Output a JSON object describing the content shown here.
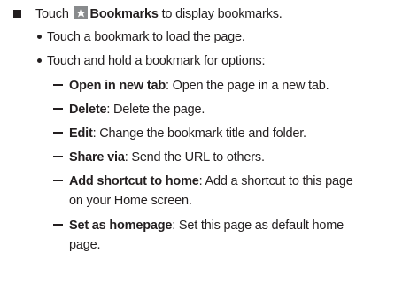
{
  "main": {
    "touch_prefix": "Touch",
    "bookmarks_label": "Bookmarks",
    "bookmarks_suffix": " to display bookmarks.",
    "icon": "star-bookmark-icon",
    "sub_items": [
      "Touch a bookmark to load the page.",
      "Touch and hold a bookmark for options:"
    ],
    "options": [
      {
        "label": "Open in new tab",
        "desc": ": Open the page in a new tab."
      },
      {
        "label": "Delete",
        "desc": ": Delete the page."
      },
      {
        "label": "Edit",
        "desc": ": Change the bookmark title and folder."
      },
      {
        "label": "Share via",
        "desc": ": Send the URL to others."
      },
      {
        "label": "Add shortcut to home",
        "desc": ": Add a shortcut to this page",
        "desc_cont": "on your Home screen."
      },
      {
        "label": "Set as homepage",
        "desc": ": Set this page as default home",
        "desc_cont": "page."
      }
    ]
  }
}
